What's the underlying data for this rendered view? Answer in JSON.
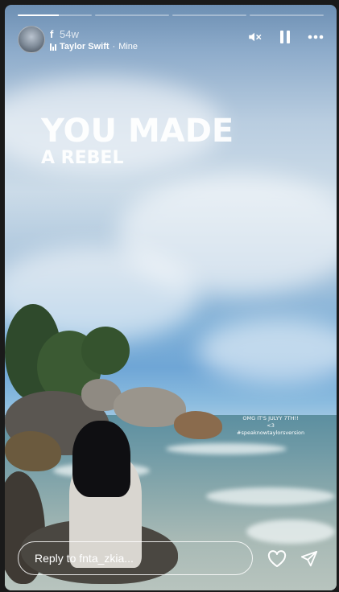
{
  "progress": {
    "segments": 4,
    "active_index": 0,
    "active_fill": 0.55
  },
  "header": {
    "username": "f",
    "time": "54w",
    "music_artist": "Taylor Swift",
    "music_separator": " · ",
    "music_track": "Mine",
    "icons": [
      "muted-speaker-icon",
      "pause-icon",
      "more-icon"
    ]
  },
  "headline": {
    "line1": "YOU MADE",
    "line2": "A REBEL"
  },
  "note": {
    "line1": "OMG IT'S JULYY 7TH!!",
    "line2": "<3",
    "line3": "#speaknowtaylorsversion"
  },
  "reply": {
    "placeholder": "Reply to fnta_zkia..."
  },
  "actions": [
    "heart-icon",
    "send-icon"
  ],
  "colors": {
    "text": "#ffffff",
    "sky": "#7fb0d8",
    "sea": "#6f9aa6"
  }
}
